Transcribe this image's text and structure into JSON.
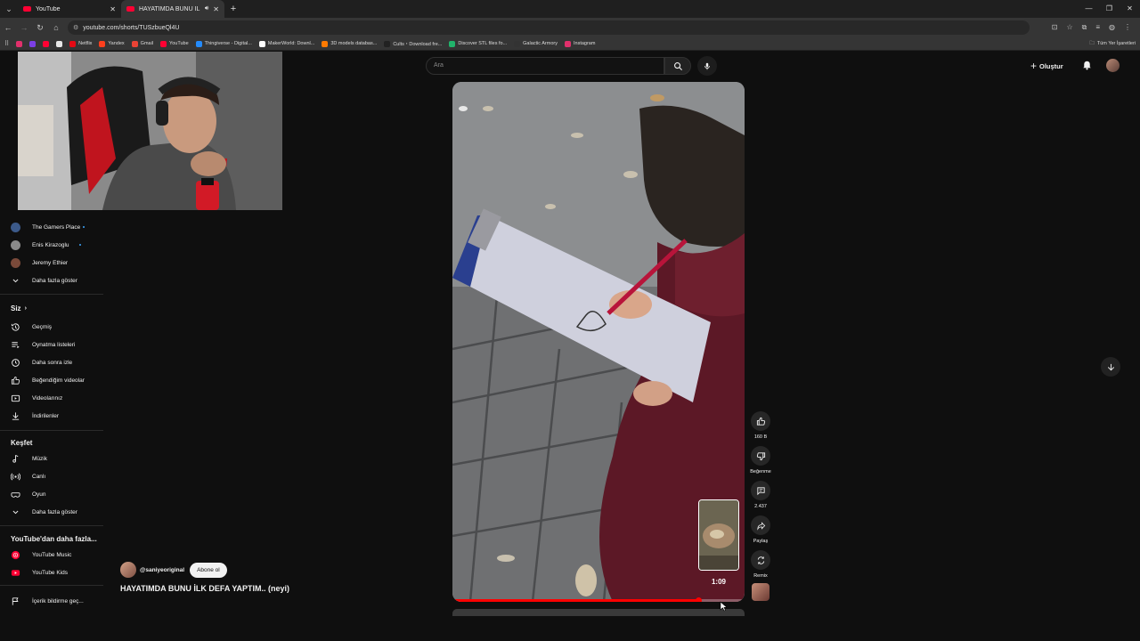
{
  "browser": {
    "tabs": [
      {
        "title": "YouTube",
        "active": false
      },
      {
        "title": "HAYATIMDA BUNU İLK DEF",
        "active": true
      }
    ],
    "url": "youtube.com/shorts/TUSzbueQl4U",
    "bookmarks": [
      {
        "label": "",
        "color": "#e1306c"
      },
      {
        "label": "",
        "color": "#7b3fe4"
      },
      {
        "label": "",
        "color": "#ff0033"
      },
      {
        "label": "",
        "color": "#e7e7e7"
      },
      {
        "label": "Netflix",
        "color": "#e50914"
      },
      {
        "label": "Yandex",
        "color": "#fc3f1d"
      },
      {
        "label": "Gmail",
        "color": "#ea4335"
      },
      {
        "label": "YouTube",
        "color": "#ff0033"
      },
      {
        "label": "Thingiverse - Digital...",
        "color": "#248bfb"
      },
      {
        "label": "MakerWorld: Downl...",
        "color": "#ffffff"
      },
      {
        "label": "3D models databas...",
        "color": "#ff7a00"
      },
      {
        "label": "Cults・Download fre...",
        "color": "#222222"
      },
      {
        "label": "Discover STL files fo...",
        "color": "#21b36b"
      },
      {
        "label": "Galactic Armory",
        "color": "#333333"
      },
      {
        "label": "Instagram",
        "color": "#e1306c"
      }
    ],
    "all_bookmarks": "Tüm Yer İşaretleri"
  },
  "header": {
    "search_placeholder": "Ara",
    "create_label": "Oluştur"
  },
  "sidebar": {
    "subscriptions": [
      {
        "label": "The Gamers Place",
        "new": true,
        "color": "#3c5a8a"
      },
      {
        "label": "Enis Kirazoglu",
        "new": true,
        "color": "#8a8a8a"
      },
      {
        "label": "Jeremy Ethier",
        "new": false,
        "color": "#7a4a3a"
      }
    ],
    "show_more_1": "Daha fazla göster",
    "you_heading": "Siz",
    "you_items": [
      {
        "label": "Geçmiş",
        "icon": "history-icon"
      },
      {
        "label": "Oynatma listeleri",
        "icon": "playlists-icon"
      },
      {
        "label": "Daha sonra izle",
        "icon": "watch-later-icon"
      },
      {
        "label": "Beğendiğim videolar",
        "icon": "like-icon"
      },
      {
        "label": "Videolarınız",
        "icon": "your-videos-icon"
      },
      {
        "label": "İndirilenler",
        "icon": "download-icon"
      }
    ],
    "explore_heading": "Keşfet",
    "explore_items": [
      {
        "label": "Müzik",
        "icon": "music-icon"
      },
      {
        "label": "Canlı",
        "icon": "live-icon"
      },
      {
        "label": "Oyun",
        "icon": "gaming-icon"
      }
    ],
    "show_more_2": "Daha fazla göster",
    "more_from_heading": "YouTube'dan daha fazla...",
    "more_from_items": [
      {
        "label": "YouTube Music",
        "icon": "youtube-music-icon"
      },
      {
        "label": "YouTube Kids",
        "icon": "youtube-kids-icon"
      }
    ],
    "report_history": "İçerik bildirme geç..."
  },
  "short": {
    "channel": "@saniyeoriginal",
    "subscribe_label": "Abone ol",
    "title": "HAYATIMDA BUNU İLK DEFA YAPTIM.. (neyi)",
    "progress": 0.84,
    "preview_time": "1:09",
    "actions": {
      "like_count": "160 B",
      "dislike_label": "Beğenme",
      "comment_count": "2.437",
      "share_label": "Paylaş",
      "remix_label": "Remix"
    }
  },
  "colors": {
    "accent": "#ff0000",
    "background": "#0f0f0f",
    "new_dot": "#3ea6ff"
  }
}
